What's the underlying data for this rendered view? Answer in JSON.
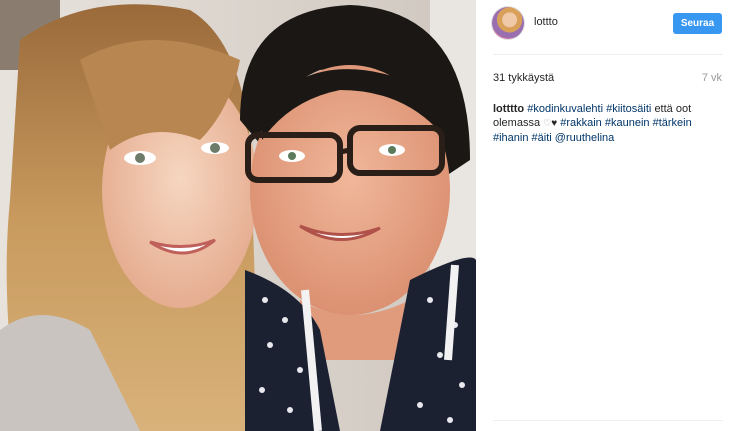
{
  "post": {
    "username": "lottto",
    "follow_label": "Seuraa",
    "likes_text": "31 tykkäystä",
    "time_ago": "7 vk",
    "caption": {
      "author": "lotttto",
      "tags": {
        "t1": "#kodinkuvalehti",
        "t2": "#kiitosäiti",
        "text1": "että oot olemassa",
        "t3": "#rakkain",
        "t4": "#kaunein",
        "t5": "#tärkein",
        "t6": "#ihanin",
        "t7": "#äiti",
        "mention": "@ruuthelina"
      }
    }
  },
  "colors": {
    "follow_button": "#3897f0",
    "hashtag": "#003569",
    "muted": "#999999"
  },
  "icons": {
    "heart_outline": "♡",
    "heart": "♥"
  }
}
